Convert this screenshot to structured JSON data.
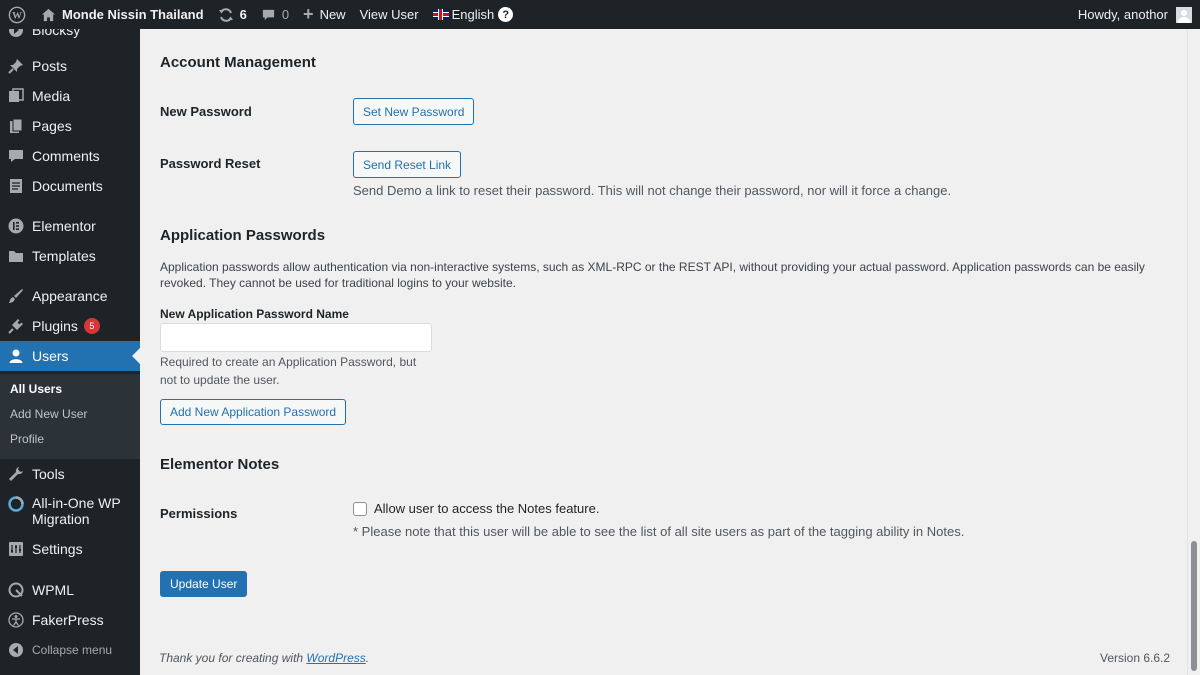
{
  "adminbar": {
    "site_name": "Monde Nissin Thailand",
    "updates_count": "6",
    "comments_count": "0",
    "new_label": "New",
    "view_user_label": "View User",
    "language_label": "English",
    "help_label": "?",
    "howdy_label": "Howdy, anothor"
  },
  "sidebar": {
    "items": [
      {
        "label": "Blocksy",
        "icon": "blocksy-icon"
      },
      {
        "label": "Posts",
        "icon": "pin-icon"
      },
      {
        "label": "Media",
        "icon": "media-icon"
      },
      {
        "label": "Pages",
        "icon": "pages-icon"
      },
      {
        "label": "Comments",
        "icon": "comment-icon"
      },
      {
        "label": "Documents",
        "icon": "documents-icon"
      },
      {
        "label": "Elementor",
        "icon": "elementor-icon"
      },
      {
        "label": "Templates",
        "icon": "folder-icon"
      },
      {
        "label": "Appearance",
        "icon": "brush-icon"
      },
      {
        "label": "Plugins",
        "icon": "plug-icon",
        "badge": "5"
      },
      {
        "label": "Users",
        "icon": "user-icon"
      },
      {
        "label": "Tools",
        "icon": "wrench-icon"
      },
      {
        "label": "All-in-One WP Migration",
        "icon": "migration-icon"
      },
      {
        "label": "Settings",
        "icon": "settings-icon"
      },
      {
        "label": "WPML",
        "icon": "wpml-icon"
      },
      {
        "label": "FakerPress",
        "icon": "fakerpress-icon"
      }
    ],
    "submenu": [
      "All Users",
      "Add New User",
      "Profile"
    ],
    "collapse_label": "Collapse menu"
  },
  "account": {
    "heading": "Account Management",
    "new_password_label": "New Password",
    "set_new_password_button": "Set New Password",
    "password_reset_label": "Password Reset",
    "send_reset_link_button": "Send Reset Link",
    "reset_description": "Send Demo a link to reset their password. This will not change their password, nor will it force a change."
  },
  "app_passwords": {
    "heading": "Application Passwords",
    "description": "Application passwords allow authentication via non-interactive systems, such as XML-RPC or the REST API, without providing your actual password. Application passwords can be easily revoked. They cannot be used for traditional logins to your website.",
    "name_label": "New Application Password Name",
    "name_value": "",
    "help_text": "Required to create an Application Password, but not to update the user.",
    "add_button": "Add New Application Password"
  },
  "elementor_notes": {
    "heading": "Elementor Notes",
    "permissions_label": "Permissions",
    "checkbox_label": "Allow user to access the Notes feature.",
    "checkbox_checked": false,
    "note": "* Please note that this user will be able to see the list of all site users as part of the tagging ability in Notes."
  },
  "update_button": "Update User",
  "footer": {
    "thanks_prefix": "Thank you for creating with ",
    "wordpress_link": "WordPress",
    "thanks_suffix": ".",
    "version": "Version 6.6.2"
  },
  "colors": {
    "adminbar_bg": "#1d2327",
    "accent": "#2271b1",
    "badge": "#d63638",
    "page_bg": "#f0f0f1"
  }
}
